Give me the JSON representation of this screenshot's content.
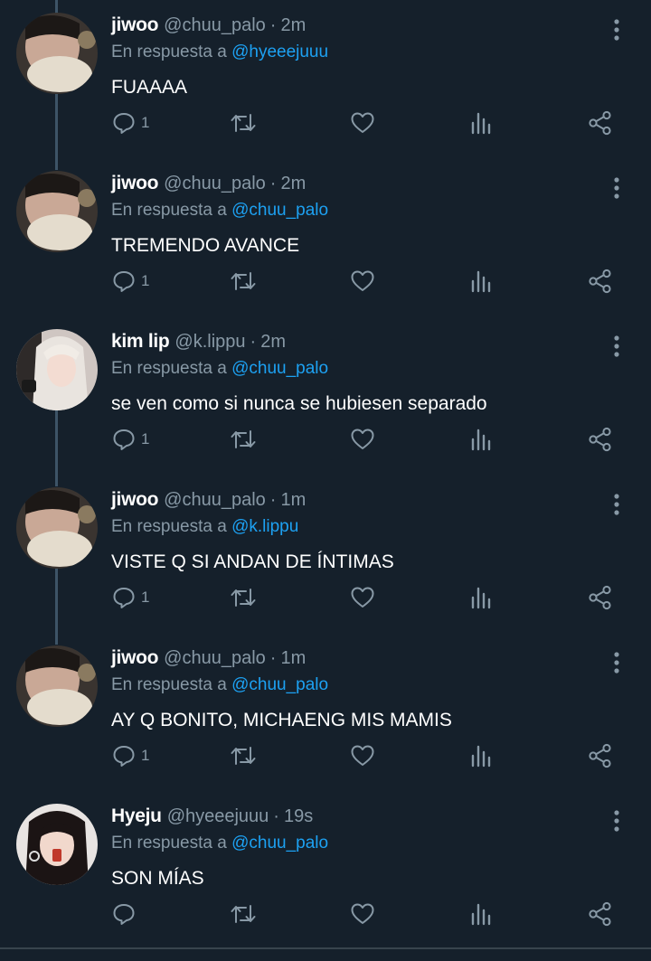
{
  "reply_prefix": "En respuesta a",
  "colors": {
    "background": "#15202b",
    "muted": "#8899a6",
    "accent": "#1da1f2",
    "thread_line": "#3d5466"
  },
  "icons": [
    "reply-icon",
    "retweet-icon",
    "like-icon",
    "analytics-icon",
    "share-icon",
    "more-options-icon"
  ],
  "tweets": [
    {
      "name": "jiwoo",
      "handle": "@chuu_palo",
      "time": "2m",
      "reply_to": "@hyeeejuuu",
      "text": "FUAAAA",
      "replies": "1"
    },
    {
      "name": "jiwoo",
      "handle": "@chuu_palo",
      "time": "2m",
      "reply_to": "@chuu_palo",
      "text": "TREMENDO AVANCE",
      "replies": "1"
    },
    {
      "name": "kim lip",
      "handle": "@k.lippu",
      "time": "2m",
      "reply_to": "@chuu_palo",
      "text": "se ven como si nunca se hubiesen separado",
      "replies": "1"
    },
    {
      "name": "jiwoo",
      "handle": "@chuu_palo",
      "time": "1m",
      "reply_to": "@k.lippu",
      "text": "VISTE Q SI ANDAN DE ÍNTIMAS",
      "replies": "1"
    },
    {
      "name": "jiwoo",
      "handle": "@chuu_palo",
      "time": "1m",
      "reply_to": "@chuu_palo",
      "text": "AY Q BONITO, MICHAENG MIS MAMIS",
      "replies": "1"
    },
    {
      "name": "Hyeju",
      "handle": "@hyeeejuuu",
      "time": "19s",
      "reply_to": "@chuu_palo",
      "text": "SON MÍAS",
      "replies": ""
    }
  ]
}
